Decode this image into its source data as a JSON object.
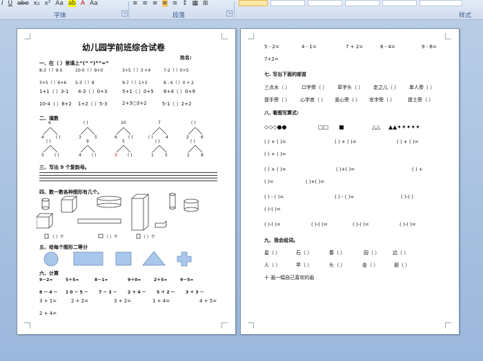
{
  "ribbon": {
    "format_buttons": [
      "I",
      "U",
      "abe",
      "x₂",
      "x²",
      "Aa",
      "ab",
      "A",
      "Aa"
    ],
    "groups": {
      "font": "字体",
      "paragraph": "段落",
      "styles": "样式"
    }
  },
  "page1": {
    "title": "幼儿园学前班综合试卷",
    "name_label": "姓名:",
    "s1": {
      "heading": "一、在（ ）里填上“(”  “)”“=”",
      "rows": [
        [
          "8-3（ ）9-5",
          "10-0（ ）9+0",
          "3+5（ ）3 +4",
          "7-2（ ）0+5"
        ],
        [
          "3+5（ ）6+6",
          "5-3（ ）8",
          "9-7（ ）1+3",
          "8 - 6（ ）0 + 2"
        ],
        [
          "1+1（ ）3-1",
          "4-3（ ）0+3",
          "5+1（ ）0+5",
          "6+4（ ）0+9"
        ],
        [
          "10-4（ ）8+2",
          "1+2（ ）5-3",
          "2+3○3+2",
          "5-1（ ）2+2"
        ]
      ]
    },
    "s2": {
      "heading": "二、填数",
      "trees_row1": [
        [
          "6",
          "4",
          "( )"
        ],
        [
          "( )",
          "3",
          "5"
        ],
        [
          "10",
          "6",
          "( )"
        ],
        [
          "7",
          "( )",
          "4"
        ],
        [
          "( )",
          "2",
          "6"
        ]
      ],
      "trees_row2": [
        [
          "( )",
          "5",
          "( )"
        ],
        [
          "9",
          "4",
          "( )"
        ],
        [
          "5",
          "3",
          "( )"
        ],
        [
          "( )",
          "1",
          "5"
        ],
        [
          "( )",
          "2",
          "8"
        ]
      ]
    },
    "s3": {
      "heading": "三、写出 9 个复韵母。"
    },
    "s4": {
      "heading": "四、数一数各种图形有几个。",
      "counts": [
        "（ ）个",
        "（ ）个",
        "（ ）个"
      ]
    },
    "s5": {
      "heading": "五、给每个图形二等分"
    },
    "s6": {
      "heading": "六、计算",
      "rows": [
        [
          "9－2=",
          "5＋5=",
          "8－1=",
          "9＋0=",
          "2＋5=",
          "9－5="
        ],
        [
          "8 － 4 －",
          "1 0 － 5 －",
          "7 － 3 －",
          "2 ＋ 4 －",
          "5 ＋ 2 －",
          "3 ＋ 3 －"
        ],
        [
          "3 + 1=",
          "2 + 2=",
          "3 + 2=",
          "1 + 4=",
          "4 + 5="
        ],
        [
          "2 + 4="
        ]
      ]
    }
  },
  "page2": {
    "top_row": [
      "5 - 2=",
      "4 - 1=",
      "7 + 2=",
      "8 - 4=",
      "9 - 6="
    ],
    "top_row2": "7+2=",
    "s7": {
      "heading": "七. 写出下面的部首",
      "row1": [
        "三点水（    ）",
        "口字旁（    ）",
        "草字头（    ）",
        "走之儿（    ）",
        "单人旁（    ）"
      ],
      "row2": [
        "提手旁（    ）",
        "心字底（    ）",
        "竖心旁（    ）",
        "言字旁（    ）",
        "提土旁（    ）"
      ]
    },
    "s8": {
      "heading": "八. 看图写算式:",
      "shapes": [
        "◇◇◇●●",
        "□□",
        "■",
        "△△",
        "▲▲✦✦✦✦✦"
      ],
      "lines": [
        [
          "(     ) + (     )=",
          "(     ) + (     )=",
          "(     ) + (     )="
        ],
        [
          "(     ) + (     )="
        ],
        [
          "(     ) + (     )=",
          "(     )+(     )=",
          "(     ) +"
        ],
        [
          "(     )=",
          "(     )+(     )="
        ],
        [
          "(     ) - (     )=",
          "(     ) - (     )=",
          "(     )-(     )"
        ],
        [
          "(     )-(     )="
        ],
        [
          "(     )-(     )=",
          "(     )-(     )=",
          "(     )-(     )=",
          "(     )-(     )="
        ]
      ]
    },
    "s9": {
      "heading": "九、我会组词。",
      "row1": [
        "星（     ）",
        "石（     ）",
        "春（     ）",
        "园（     ）",
        "边（     ）"
      ],
      "row2": [
        "人（     ）",
        "早（     ）",
        "头（     ）",
        "金（     ）",
        "朋（     ）"
      ]
    },
    "s10": {
      "heading": "十 画一幅自己喜欢的画"
    }
  }
}
